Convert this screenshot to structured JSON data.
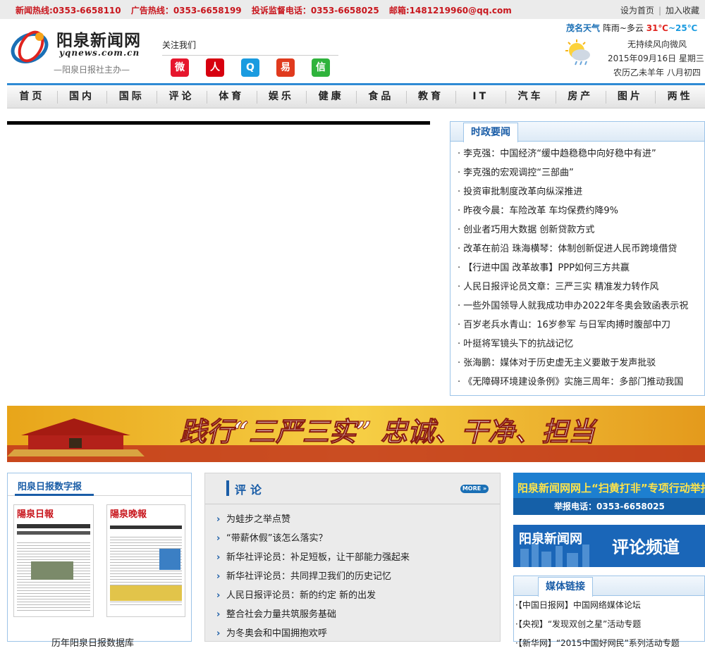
{
  "topbar": {
    "news_hotline": "新闻热线:0353-6658110",
    "ad_hotline": "广告热线：0353-6658199",
    "complaint": "投诉监督电话：0353-6658025",
    "email": "邮箱:1481219960@qq.com",
    "set_home": "设为首页",
    "add_favorite": "加入收藏"
  },
  "logo": {
    "title": "阳泉新闻网",
    "domain": "yqnews.com.cn",
    "sub": "—阳泉日报社主办—"
  },
  "follow": {
    "label": "关注我们",
    "icons": [
      {
        "name": "weibo-icon",
        "glyph": "微",
        "color": "#e6162d"
      },
      {
        "name": "people-icon",
        "glyph": "人",
        "color": "#d7000f"
      },
      {
        "name": "tencent-weibo-icon",
        "glyph": "Q",
        "color": "#1a9be0"
      },
      {
        "name": "netease-icon",
        "glyph": "易",
        "color": "#e03a1e"
      },
      {
        "name": "wechat-icon",
        "glyph": "信",
        "color": "#2fb33c"
      }
    ]
  },
  "weather": {
    "city": "茂名天气",
    "condition": "阵雨~多云",
    "high": "31℃",
    "sep": "~",
    "low": "25℃",
    "wind": "无持续风向微风",
    "date": "2015年09月16日 星期三",
    "lunar": "农历乙未羊年 八月初四"
  },
  "nav": [
    "首页",
    "国内",
    "国际",
    "评论",
    "体育",
    "娱乐",
    "健康",
    "食品",
    "教育",
    "IT",
    "汽车",
    "房产",
    "图片",
    "两性"
  ],
  "politics": {
    "title": "时政要闻",
    "items": [
      "· 李克强：中国经济“缓中趋稳稳中向好稳中有进”",
      "· 李克强的宏观调控“三部曲”",
      "· 投资审批制度改革向纵深推进",
      "· 昨夜今晨：车险改革 车均保费约降9%",
      "· 创业者巧用大数据 创新贷款方式",
      "· 改革在前沿 珠海横琴：体制创新促进人民币跨境借贷",
      "· 【行进中国 改革故事】PPP如何三方共赢",
      "· 人民日报评论员文章：三严三实 精准发力转作风",
      "· 一些外国领导人就我成功申办2022年冬奥会致函表示祝",
      "· 百岁老兵水青山：16岁参军 与日军肉搏时腹部中刀",
      "· 叶挺将军镜头下的抗战记忆",
      "· 张海鹏：媒体对于历史虚无主义要敢于发声批驳",
      "· 《无障碍环境建设条例》实施三周年：多部门推动我国"
    ]
  },
  "banner": {
    "slogan": "践行“三严三实” 忠诚、干净、担当"
  },
  "paper": {
    "title": "阳泉日报数字报",
    "paper1_name": "陽泉日報",
    "paper2_name": "陽泉晚報",
    "caption": "历年阳泉日报数据库"
  },
  "comment": {
    "title": "评论",
    "more": "MORE »",
    "items": [
      "为蛙步之举点赞",
      "“带薪休假”该怎么落实？",
      "新华社评论员：补足短板，让干部能力强起来",
      "新华社评论员：共同捍卫我们的历史记忆",
      "人民日报评论员：新的约定 新的出发",
      "整合社会力量共筑服务基础",
      "为冬奥会和中国拥抱欢呼"
    ]
  },
  "ads": {
    "ad1_line1": "阳泉新闻网网上“扫黄打非”专项行动举报中心",
    "ad1_line2": "举报电话：0353-6658025",
    "ad2_line1": "阳泉新闻网",
    "ad2_line2": "评论频道"
  },
  "media": {
    "title": "媒体链接",
    "items": [
      "·【中国日报网】中国网络媒体论坛",
      "·【央视】“发现双创之星”活动专题",
      "·【新华网】“2015中国好网民”系列活动专题"
    ]
  },
  "colors": {
    "accent_red": "#c8161d",
    "nav_blue": "#2f8ad4",
    "title_blue": "#1a5da7"
  }
}
